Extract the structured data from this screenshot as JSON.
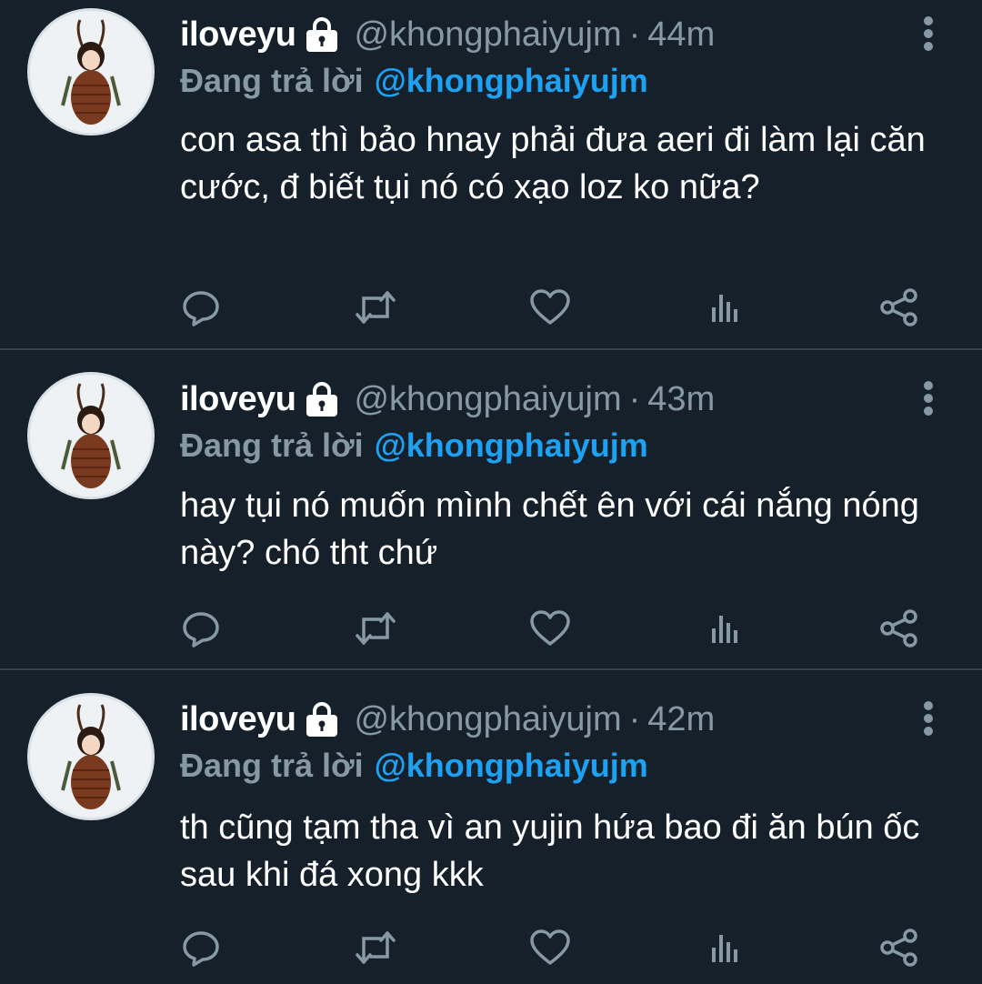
{
  "tweets": [
    {
      "name": "iloveyu",
      "handle": "@khongphaiyujm",
      "separator": "·",
      "time": "44m",
      "reply_prefix": "Đang trả lời",
      "reply_to": "@khongphaiyujm",
      "text": "con asa thì bảo hnay phải đưa aeri đi làm lại căn cước, đ biết tụi nó có xạo loz ko nữa?"
    },
    {
      "name": "iloveyu",
      "handle": "@khongphaiyujm",
      "separator": "·",
      "time": "43m",
      "reply_prefix": "Đang trả lời",
      "reply_to": "@khongphaiyujm",
      "text": "hay tụi nó muốn mình chết ên với cái nắng nóng này? chó tht chứ"
    },
    {
      "name": "iloveyu",
      "handle": "@khongphaiyujm",
      "separator": "·",
      "time": "42m",
      "reply_prefix": "Đang trả lời",
      "reply_to": "@khongphaiyujm",
      "text": "th cũng tạm tha vì an yujin hứa bao đi ăn bún ốc sau khi đá xong kkk"
    }
  ],
  "icons": {
    "reply": "reply-icon",
    "retweet": "retweet-icon",
    "like": "heart-icon",
    "views": "analytics-icon",
    "share": "share-icon",
    "more": "more-vertical-icon",
    "lock": "lock-icon"
  },
  "colors": {
    "background": "#15202b",
    "divider": "#38444d",
    "secondary_text": "#8899a6",
    "link": "#1da1f2",
    "primary_text": "#ffffff"
  }
}
